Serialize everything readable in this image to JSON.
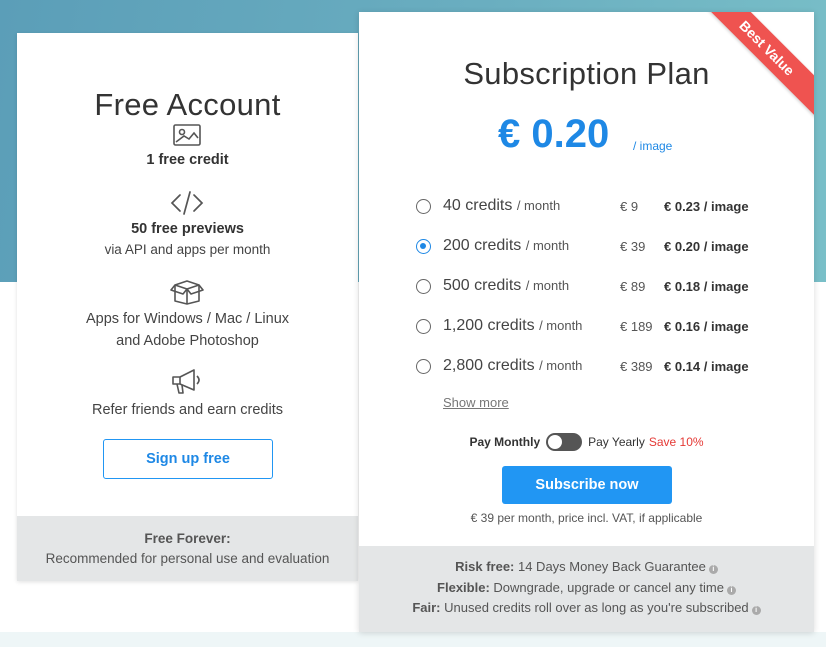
{
  "free": {
    "title": "Free Account",
    "features": [
      {
        "icon": "image-icon",
        "bold": "1 free credit",
        "text": ""
      },
      {
        "icon": "code-icon",
        "bold": "50 free previews",
        "text": "via API and apps per month"
      },
      {
        "icon": "box-icon",
        "bold": "",
        "text": "Apps for Windows / Mac / Linux",
        "text2": "and Adobe Photoshop"
      },
      {
        "icon": "megaphone-icon",
        "bold": "",
        "text": "Refer friends and earn credits"
      }
    ],
    "signup_label": "Sign up free",
    "footer_title": "Free Forever:",
    "footer_text": "Recommended for personal use and evaluation"
  },
  "subscription": {
    "ribbon": "Best Value",
    "title": "Subscription Plan",
    "price": "€ 0.20",
    "price_unit": "/ image",
    "plans": [
      {
        "credits": "40 credits",
        "per": "/ month",
        "price": "€ 9",
        "per_image": "€ 0.23 / image",
        "selected": false
      },
      {
        "credits": "200 credits",
        "per": "/ month",
        "price": "€ 39",
        "per_image": "€ 0.20 / image",
        "selected": true
      },
      {
        "credits": "500 credits",
        "per": "/ month",
        "price": "€ 89",
        "per_image": "€ 0.18 / image",
        "selected": false
      },
      {
        "credits": "1,200 credits",
        "per": "/ month",
        "price": "€ 189",
        "per_image": "€ 0.16 / image",
        "selected": false
      },
      {
        "credits": "2,800 credits",
        "per": "/ month",
        "price": "€ 389",
        "per_image": "€ 0.14 / image",
        "selected": false
      }
    ],
    "show_more": "Show more",
    "pay_monthly": "Pay Monthly",
    "pay_yearly": "Pay Yearly",
    "save": "Save 10%",
    "subscribe_label": "Subscribe now",
    "vat_note": "€ 39 per month, price incl. VAT, if applicable",
    "footer": [
      {
        "strong": "Risk free:",
        "text": " 14 Days Money Back Guarantee"
      },
      {
        "strong": "Flexible:",
        "text": " Downgrade, upgrade or cancel any time"
      },
      {
        "strong": "Fair:",
        "text": " Unused credits roll over as long as you're subscribed"
      }
    ]
  },
  "colors": {
    "accent": "#2196f3",
    "ribbon": "#ef5350",
    "save": "#e53935"
  }
}
